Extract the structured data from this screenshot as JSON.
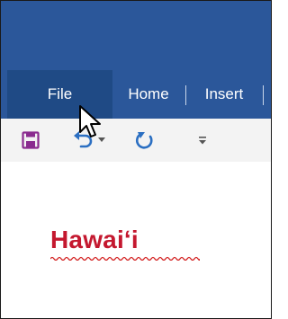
{
  "ribbon": {
    "tabs": [
      {
        "label": "File"
      },
      {
        "label": "Home"
      },
      {
        "label": "Insert"
      }
    ]
  },
  "quick_access": {
    "items": [
      {
        "icon": "save-icon"
      },
      {
        "icon": "undo-icon"
      },
      {
        "icon": "undo-dropdown-icon"
      },
      {
        "icon": "redo-icon"
      },
      {
        "icon": "customize-qat-icon"
      }
    ]
  },
  "document": {
    "text": "Hawaiʻi"
  },
  "colors": {
    "ribbon_blue": "#2b579a",
    "active_tab_blue": "#1f4a85",
    "text_red": "#c4182f",
    "qat_background": "#f3f3f3"
  }
}
